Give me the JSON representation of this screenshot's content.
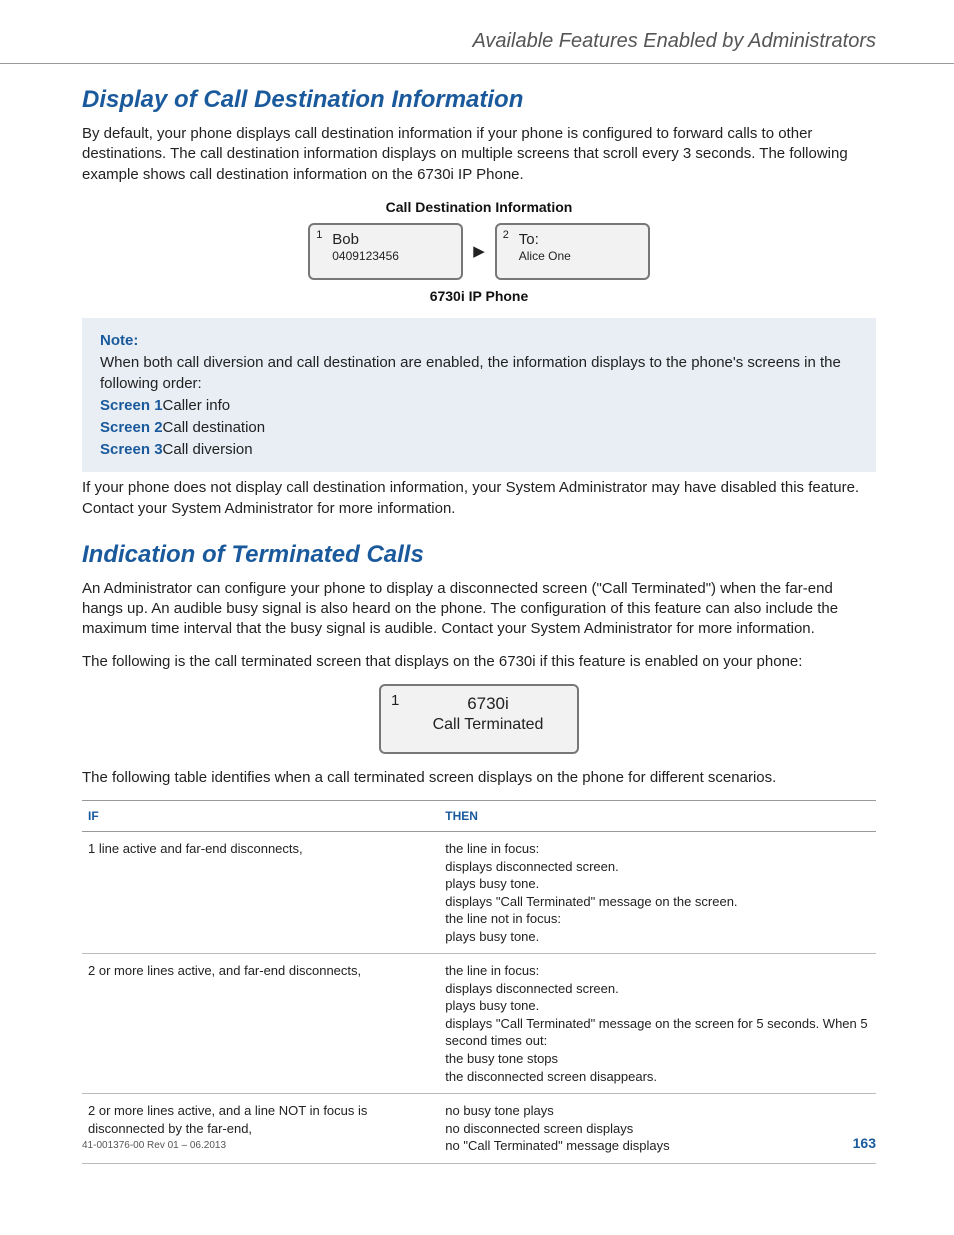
{
  "header": {
    "title": "Available Features Enabled by Administrators"
  },
  "section1": {
    "heading": "Display of Call Destination Information",
    "p1": "By default, your phone displays call destination information if your phone is configured to forward calls to other destinations. The call destination information displays on multiple screens that scroll every 3 seconds. The following example shows call destination information on the 6730i IP Phone.",
    "fig_top": "Call Destination Information",
    "fig_bottom": "6730i IP Phone",
    "screen1": {
      "num": "1",
      "line1": "Bob",
      "line2": "0409123456"
    },
    "arrow": "▶",
    "screen2": {
      "num": "2",
      "line1": "To:",
      "line2": "Alice One"
    },
    "note": {
      "label": "Note:",
      "text": "When both call diversion and call destination are enabled, the information displays to the phone's screens in the following order:",
      "s1l": "Screen 1",
      "s1v": "Caller info",
      "s2l": "Screen 2",
      "s2v": "Call destination",
      "s3l": "Screen 3",
      "s3v": "Call diversion"
    },
    "p2": "If your phone does not display call destination information, your System Administrator may have disabled this feature. Contact your System Administrator for more information."
  },
  "section2": {
    "heading": "Indication of Terminated Calls",
    "p1": "An Administrator can configure your phone to display a disconnected screen (\"Call Terminated\") when the far-end hangs up. An audible busy signal is also heard on the phone. The configuration of this feature can also include the maximum time interval that the busy signal is audible. Contact your System Administrator for more information.",
    "p2": "The following is the call terminated screen that displays on the 6730i if this feature is enabled on your phone:",
    "term_screen": {
      "num": "1",
      "line1": "6730i",
      "line2": "Call Terminated"
    },
    "p3": "The following table identifies when a call terminated screen displays on the phone for different scenarios.",
    "table": {
      "h1": "IF",
      "h2": "THEN",
      "rows": [
        {
          "if": "1 line active and far-end disconnects,",
          "then": "the line in focus:\ndisplays disconnected screen.\nplays busy tone.\ndisplays \"Call Terminated\" message on the screen.\nthe line not in focus:\nplays busy tone."
        },
        {
          "if": "2 or more lines active, and far-end disconnects,",
          "then": "the line in focus:\ndisplays disconnected screen.\nplays busy tone.\ndisplays \"Call Terminated\" message on the screen for 5 seconds. When 5 second times out:\nthe busy tone stops\nthe disconnected screen disappears."
        },
        {
          "if": "2 or more lines active, and a line NOT in focus is disconnected by the far-end,",
          "then": "no busy tone plays\nno disconnected screen displays\nno \"Call Terminated\" message displays"
        }
      ]
    }
  },
  "footer": {
    "rev": "41-001376-00 Rev 01 – 06.2013",
    "page": "163"
  }
}
